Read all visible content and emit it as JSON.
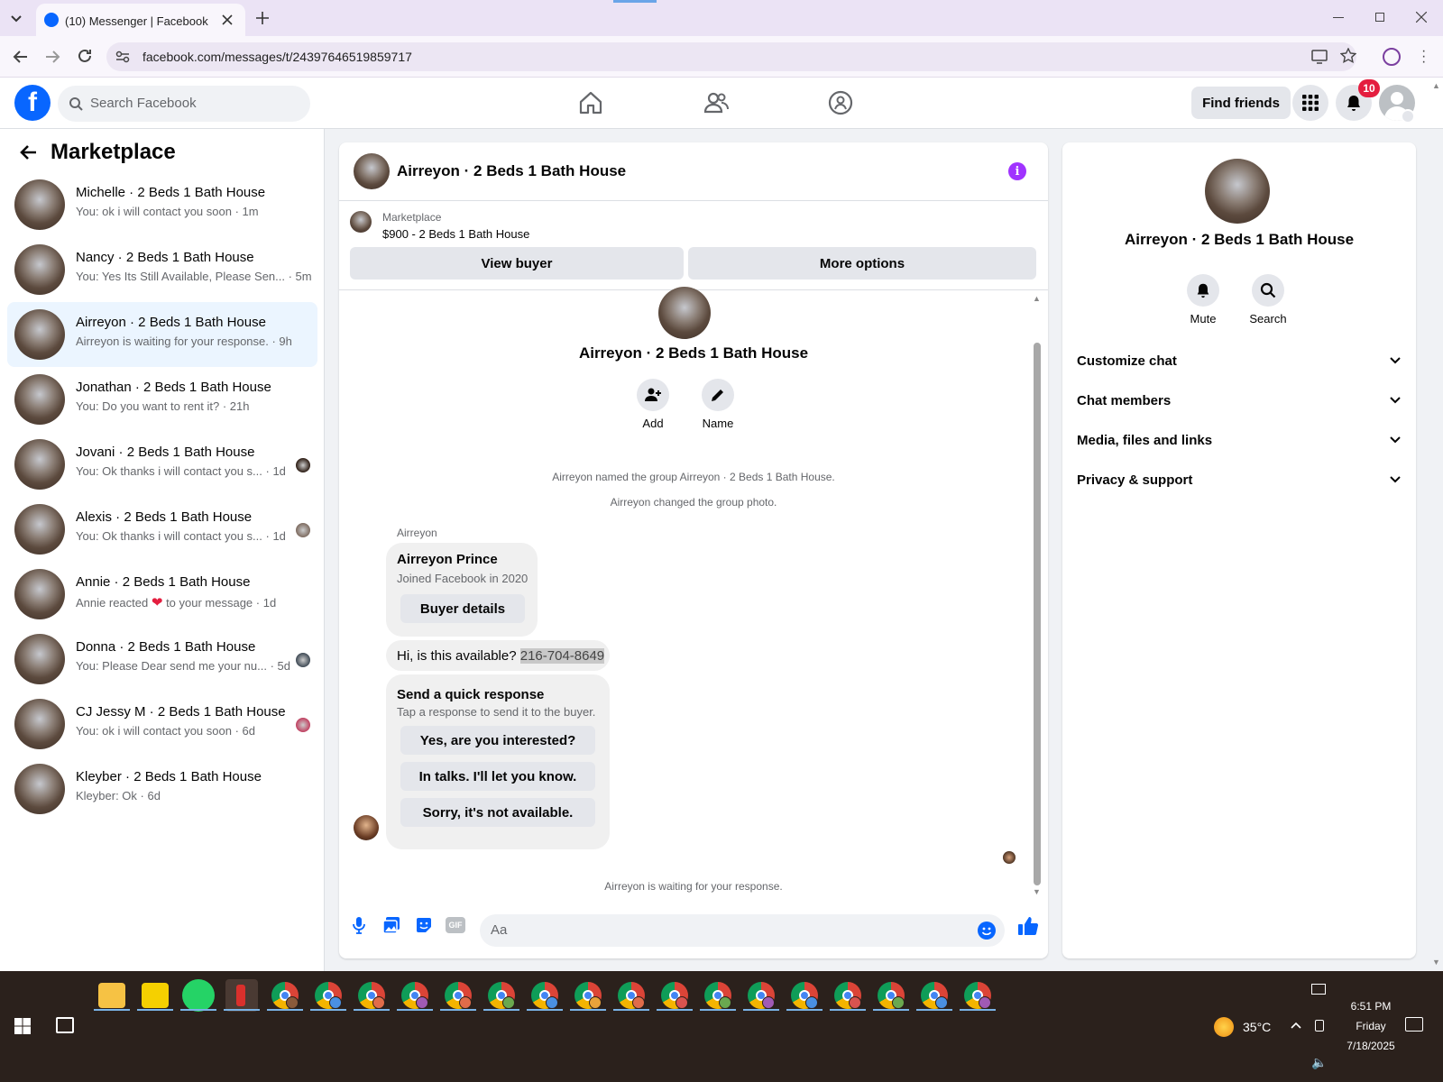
{
  "browser": {
    "tab_title": "(10) Messenger | Facebook",
    "url": "facebook.com/messages/t/24397646519859717"
  },
  "header": {
    "search_placeholder": "Search Facebook",
    "find_friends": "Find friends",
    "notification_count": "10"
  },
  "sidebar": {
    "title": "Marketplace",
    "conversations": [
      {
        "name": "Michelle · 2 Beds 1 Bath House",
        "snippet": "You: ok i will contact you soon · 1m"
      },
      {
        "name": "Nancy · 2 Beds 1 Bath House",
        "snippet": "You: Yes Its Still Available, Please Sen... · 5m"
      },
      {
        "name": "Airreyon · 2 Beds 1 Bath House",
        "snippet": "Airreyon is waiting for your response. · 9h"
      },
      {
        "name": "Jonathan · 2 Beds 1 Bath House",
        "snippet": "You: Do you want to rent it? · 21h"
      },
      {
        "name": "Jovani · 2 Beds 1 Bath House",
        "snippet": "You: Ok thanks i will contact you s... · 1d"
      },
      {
        "name": "Alexis · 2 Beds 1 Bath House",
        "snippet": "You: Ok thanks i will contact you s... · 1d"
      },
      {
        "name": "Annie · 2 Beds 1 Bath House",
        "snippet_pre": "Annie reacted",
        "snippet_post": "to your message · 1d"
      },
      {
        "name": "Donna · 2 Beds 1 Bath House",
        "snippet": "You: Please Dear send me your nu... · 5d"
      },
      {
        "name": "CJ Jessy M · 2 Beds 1 Bath House",
        "snippet": "You: ok i will contact you soon · 6d"
      },
      {
        "name": "Kleyber · 2 Beds 1 Bath House",
        "snippet": "Kleyber: Ok · 6d"
      }
    ]
  },
  "chat": {
    "title": "Airreyon · 2 Beds 1 Bath House",
    "listing_label": "Marketplace",
    "listing_price": "$900 - 2 Beds 1 Bath House",
    "view_buyer": "View buyer",
    "more_options": "More options",
    "group_name": "Airreyon · 2 Beds 1 Bath House",
    "add_label": "Add",
    "name_label": "Name",
    "sys_named": "Airreyon named the group Airreyon · 2 Beds 1 Bath House.",
    "sys_photo": "Airreyon changed the group photo.",
    "sender": "Airreyon",
    "card_name": "Airreyon Prince",
    "card_sub": "Joined Facebook in 2020",
    "buyer_details": "Buyer details",
    "message_text": "Hi, is this available?",
    "message_phone": "216-704-8649",
    "quick_title": "Send a quick response",
    "quick_sub": "Tap a response to send it to the buyer.",
    "quick_options": [
      "Yes, are you interested?",
      "In talks. I'll let you know.",
      "Sorry, it's not available."
    ],
    "waiting": "Airreyon is waiting for your response.",
    "composer_placeholder": "Aa"
  },
  "info": {
    "name": "Airreyon · 2 Beds 1 Bath House",
    "mute": "Mute",
    "search": "Search",
    "sections": [
      "Customize chat",
      "Chat members",
      "Media, files and links",
      "Privacy & support"
    ]
  },
  "taskbar": {
    "weather": "35°C",
    "time": "6:51 PM",
    "day": "Friday",
    "date": "7/18/2025"
  },
  "colors": {
    "fb_blue": "#0866ff",
    "active_conv": "#ebf5ff",
    "badge_red": "#e41e3f",
    "info_purple": "#a033ff"
  }
}
